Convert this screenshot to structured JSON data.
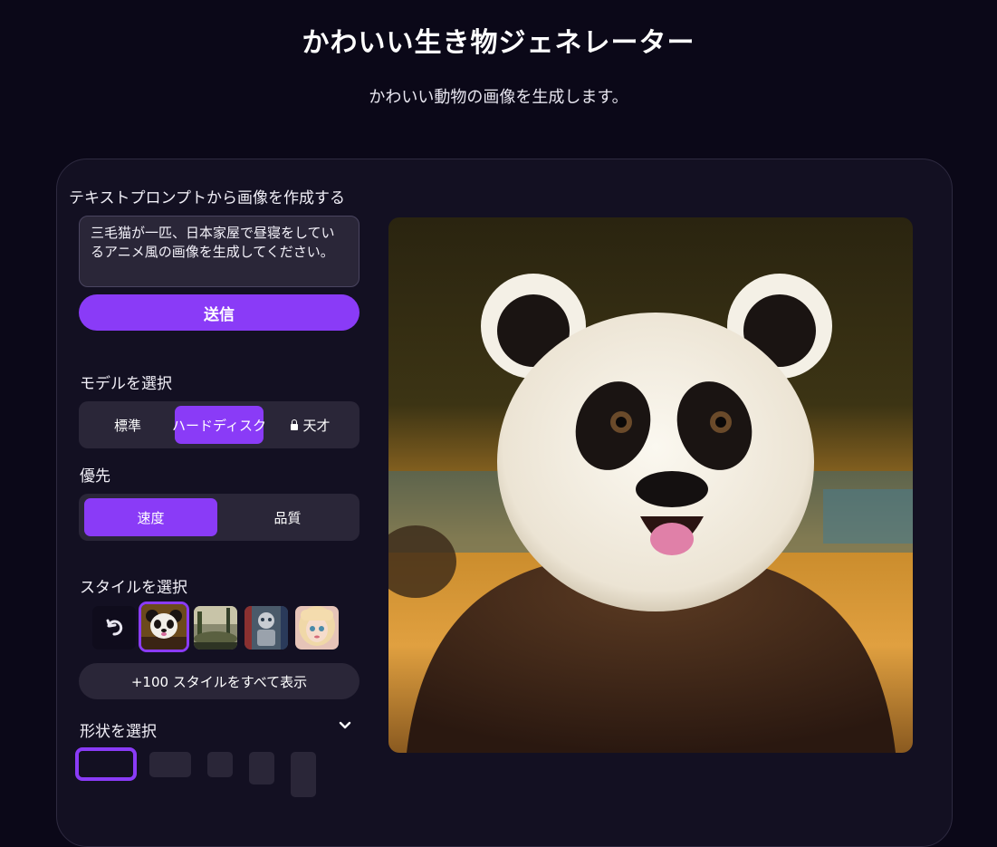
{
  "header": {
    "title": "かわいい生き物ジェネレーター",
    "subtitle": "かわいい動物の画像を生成します。"
  },
  "prompt": {
    "section_label": "テキストプロンプトから画像を作成する",
    "value": "三毛猫が一匹、日本家屋で昼寝をしているアニメ風の画像を生成してください。",
    "submit_label": "送信"
  },
  "model": {
    "label": "モデルを選択",
    "options": [
      "標準",
      "ハードディスク",
      "天才"
    ],
    "selected": "ハードディスク",
    "locked_option": "天才"
  },
  "priority": {
    "label": "優先",
    "options": [
      "速度",
      "品質"
    ],
    "selected": "速度"
  },
  "style": {
    "label": "スタイルを選択",
    "thumbnails": [
      "no-style-icon",
      "panda",
      "landscape",
      "robot",
      "anime-girl"
    ],
    "selected": "panda",
    "show_all_label": "+100 スタイルをすべて表示"
  },
  "shape": {
    "label": "形状を選択",
    "options": [
      "landscape-wide",
      "landscape",
      "square",
      "portrait",
      "tall-portrait"
    ],
    "selected": "landscape-wide"
  },
  "result": {
    "subject": "panda"
  },
  "colors": {
    "background": "#0b0818",
    "card": "#131022",
    "accent": "#8a3bf7",
    "control": "#2a2638"
  }
}
